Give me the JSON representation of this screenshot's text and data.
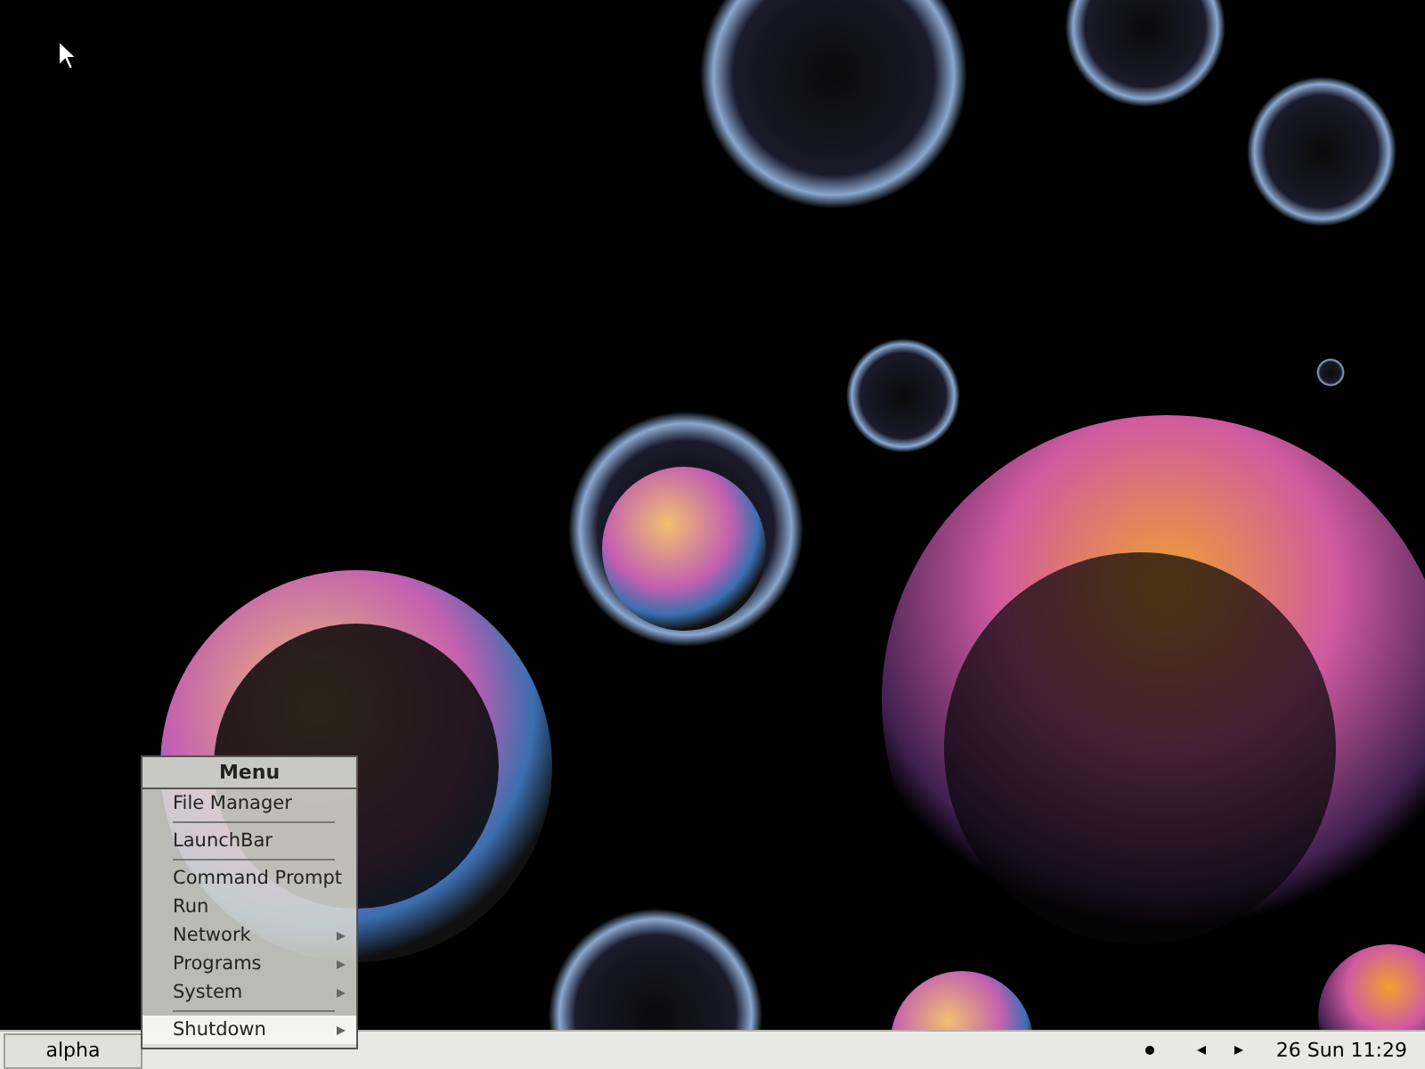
{
  "menu": {
    "title": "Menu",
    "items": [
      {
        "kind": "item",
        "label": "File Manager",
        "submenu": false,
        "selected": false
      },
      {
        "kind": "separator"
      },
      {
        "kind": "item",
        "label": "LaunchBar",
        "submenu": false,
        "selected": false
      },
      {
        "kind": "separator"
      },
      {
        "kind": "item",
        "label": "Command Prompt",
        "submenu": false,
        "selected": false
      },
      {
        "kind": "item",
        "label": "Run",
        "submenu": false,
        "selected": false
      },
      {
        "kind": "item",
        "label": "Network",
        "submenu": true,
        "selected": false
      },
      {
        "kind": "item",
        "label": "Programs",
        "submenu": true,
        "selected": false
      },
      {
        "kind": "item",
        "label": "System",
        "submenu": true,
        "selected": false
      },
      {
        "kind": "separator"
      },
      {
        "kind": "item",
        "label": "Shutdown",
        "submenu": true,
        "selected": true
      }
    ]
  },
  "taskbar": {
    "task": {
      "label": "alpha"
    },
    "clock": "26 Sun 11:29"
  }
}
